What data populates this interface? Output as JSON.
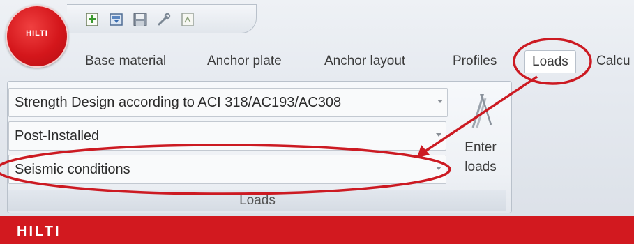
{
  "app": {
    "logo_text": "HILTI",
    "footer_logo_text": "HILTI"
  },
  "quick_access": [
    {
      "name": "new-file-icon"
    },
    {
      "name": "open-file-icon"
    },
    {
      "name": "save-icon"
    },
    {
      "name": "tools-icon"
    },
    {
      "name": "pdf-export-icon"
    }
  ],
  "tabs": [
    {
      "label": "Base material",
      "active": false
    },
    {
      "label": "Anchor plate",
      "active": false
    },
    {
      "label": "Anchor layout",
      "active": false
    },
    {
      "label": "Profiles",
      "active": false
    },
    {
      "label": "Loads",
      "active": true
    },
    {
      "label": "Calcu",
      "active": false
    }
  ],
  "loads_panel": {
    "design_method": "Strength Design according to ACI 318/AC193/AC308",
    "anchor_type": "Post-Installed",
    "conditions": "Seismic conditions",
    "enter_button": {
      "line1": "Enter",
      "line2": "loads"
    },
    "group_label": "Loads"
  },
  "colors": {
    "brand_red": "#d2191f",
    "annotation_red": "#cc1a22",
    "ribbon_bg": "#eef1f5"
  }
}
